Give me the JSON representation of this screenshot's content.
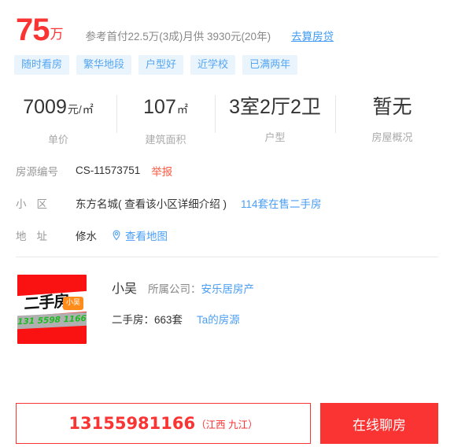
{
  "price": {
    "amount": "75",
    "unit": "万",
    "note": "参考首付22.5万(3成)月供 3930元(20年)",
    "loan_link": "去算房贷",
    "color": "#fa3333"
  },
  "tags": [
    {
      "label": "随时看房"
    },
    {
      "label": "繁华地段"
    },
    {
      "label": "户型好"
    },
    {
      "label": "近学校"
    },
    {
      "label": "已满两年"
    }
  ],
  "tag_colors": {
    "bg": "#eaf4fd",
    "text": "#55a6f3"
  },
  "stats": [
    {
      "value": "7009",
      "small": "元/",
      "sup": "㎡",
      "label": "单价"
    },
    {
      "value": "107",
      "small": "",
      "sup": "㎡",
      "label": "建筑面积"
    },
    {
      "value": "3室2厅2卫",
      "small": "",
      "sup": "",
      "label": "户型"
    },
    {
      "value": "暂无",
      "small": "",
      "sup": "",
      "label": "房屋概况"
    }
  ],
  "details": {
    "house_id": {
      "key": "房源编号",
      "value": "CS-11573751",
      "report_label": "举报",
      "report_color": "#fa5a42"
    },
    "community": {
      "key": "小区",
      "value": "东方名城( 查看该小区详细介绍 )",
      "link_label": "114套在售二手房"
    },
    "address": {
      "key": "地址",
      "value": "修水",
      "map_link": "查看地图",
      "map_icon": "location-pin-icon"
    }
  },
  "agent": {
    "avatar": {
      "title": "二手房",
      "badge": "小吴",
      "phone": "131 5598 1166",
      "bg_color": "#fa1111",
      "phone_color": "#1dbb22",
      "badge_color": "#ff8c1a"
    },
    "name": "小吴",
    "company_label": "所属公司：",
    "company": "安乐居房产",
    "listing_count_label": "二手房：663套",
    "listings_link": "Ta的房源"
  },
  "bottom_bar": {
    "phone": "13155981166",
    "region": "（江西 九江）",
    "chat_label": "在线聊房",
    "accent": "#fa3333"
  }
}
